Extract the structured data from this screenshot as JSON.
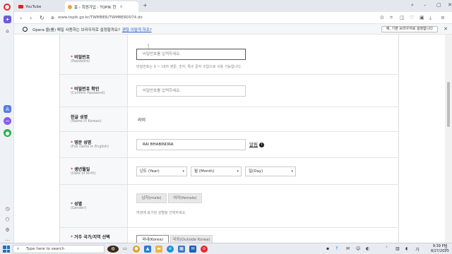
{
  "browser": {
    "tabs": [
      {
        "label": "YouTube",
        "active": false,
        "icon": "youtube-icon"
      },
      {
        "label": "홈 › 회원가입 : TOPIK 한",
        "active": true,
        "icon": "topik-favicon"
      }
    ],
    "url": "www.topik.go.kr/TWMBER/TWMBER0074.do",
    "notification": {
      "text": "Opera 을(를) 매일 사용하는 브라우저로 설정할까요?",
      "link": "괜찮 어떻게 하죠?",
      "button": "예, 기본 브라우저로 설정합니다"
    }
  },
  "form": {
    "password": {
      "label": "비밀번호",
      "sublabel": "(Password)",
      "placeholder": "비밀번호를 입력하세요.",
      "hint": "비밀번호는 9 ~ 16자 영문, 숫자, 특수 문자 조합으로 사용 가능합니다."
    },
    "confirm_password": {
      "label": "비밀번호 확인",
      "sublabel": "(Confirm Password)",
      "placeholder": "비밀번호를 입력하세요."
    },
    "korean_name": {
      "label": "한글 성명",
      "sublabel": "(Name in Korean)",
      "value": "라이"
    },
    "english_name": {
      "label": "영문 성명",
      "sublabel": "(Full name in English)",
      "value": "RAI BHABINDRA",
      "help": "알림"
    },
    "birth": {
      "label": "생년월일",
      "sublabel": "(Date of birth)",
      "year": "년도 (Year)",
      "month": "월 (Month)",
      "day": "일(Day)"
    },
    "gender": {
      "label": "성별",
      "sublabel": "(Gender)",
      "male": "남자(male)",
      "female": "여자(female)",
      "hint": "여권에 표기된 성별을 선택하세요."
    },
    "country": {
      "label": "거주 국가/지역 선택",
      "option1": "국내(Korea)",
      "option2": "국외(Outside Korea)"
    }
  },
  "taskbar": {
    "search_placeholder": "Type here to search",
    "time": "9:39 PM",
    "date": "8/27/2023"
  },
  "colors": {
    "opera_red": "#e8262f",
    "required": "#e23a3a",
    "link": "#2a63c7"
  }
}
